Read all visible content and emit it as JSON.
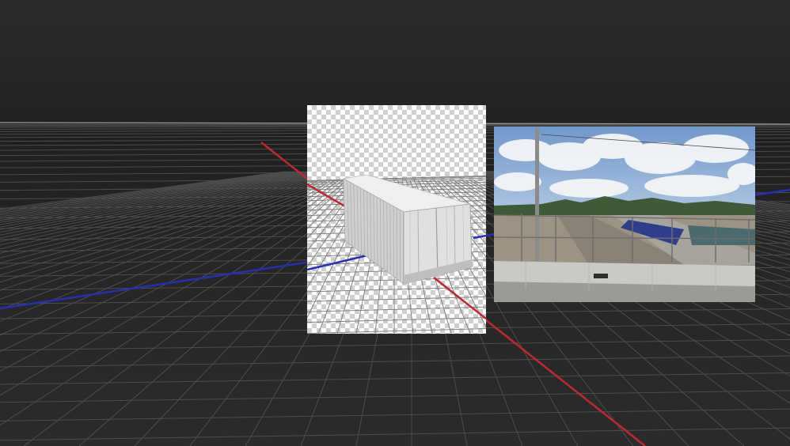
{
  "viewport": {
    "background": "#262626",
    "horizon_color": "#9a9a9a",
    "grid_color": "#5a5a5a",
    "x_axis_color": "#c4262e",
    "z_axis_color": "#2430b8"
  },
  "panels": {
    "render": {
      "subject": "shipping-container",
      "container_color": "#d8d8d8",
      "background": "transparent-checkerboard"
    },
    "photo": {
      "subject": "overpass-street-photo",
      "sky_color": "#7ea6d6"
    }
  }
}
